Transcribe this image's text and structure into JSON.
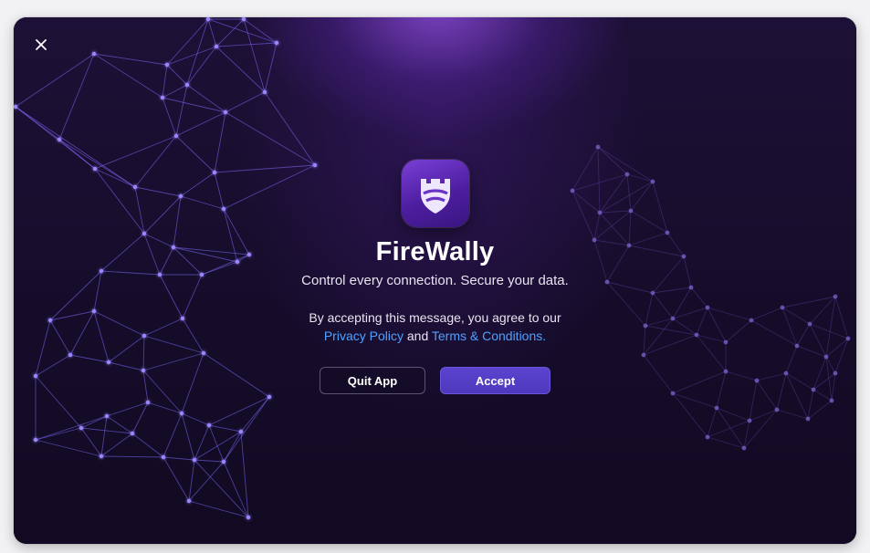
{
  "window": {
    "close_icon": "close-icon"
  },
  "app": {
    "icon": "firewall-shield-icon",
    "name": "FireWally",
    "tagline": "Control every connection. Secure your data."
  },
  "consent": {
    "prefix": "By accepting this message, you agree to our",
    "privacy_link": "Privacy Policy",
    "conjunction": "and",
    "terms_link": "Terms & Conditions."
  },
  "buttons": {
    "quit_label": "Quit App",
    "accept_label": "Accept"
  },
  "colors": {
    "background": "#140b25",
    "accent": "#5c44cf",
    "link": "#4ea1ff",
    "network_left": "#8a6cff",
    "network_right": "#6a4fb8"
  }
}
